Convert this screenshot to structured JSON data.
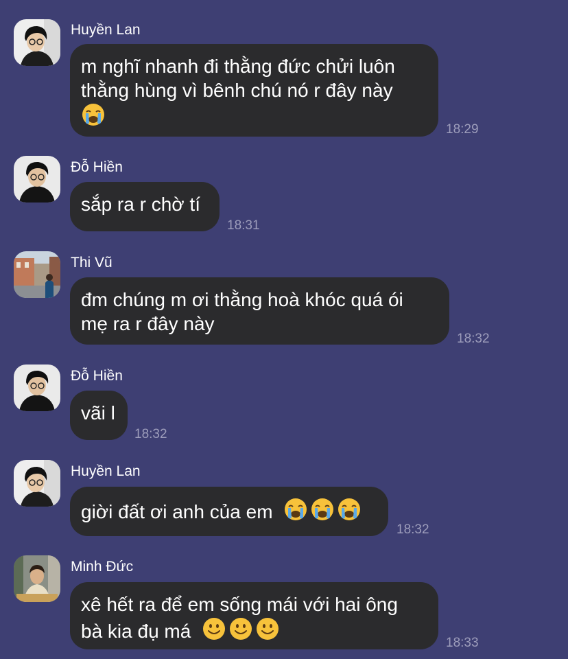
{
  "messages": [
    {
      "sender": "Huyền Lan",
      "avatar": "boy-glasses-avatar",
      "lines": [
        "m nghĩ nhanh đi thằng đức chửi luôn",
        "thằng hùng vì bênh chú nó r đây này"
      ],
      "emoji_line": [
        "loudly-crying-face"
      ],
      "time": "18:29"
    },
    {
      "sender": "Đỗ Hiền",
      "avatar": "boy-dark-avatar",
      "lines": [
        "sắp ra r chờ tí"
      ],
      "time": "18:31"
    },
    {
      "sender": "Thi Vũ",
      "avatar": "street-photo-avatar",
      "lines": [
        "đm chúng m ơi thằng hoà khóc quá ói",
        "mẹ ra r đây này"
      ],
      "time": "18:32"
    },
    {
      "sender": "Đỗ Hiền",
      "avatar": "boy-dark-avatar",
      "lines": [
        "vãi l"
      ],
      "time": "18:32"
    },
    {
      "sender": "Huyền Lan",
      "avatar": "boy-glasses-avatar",
      "lines": [
        "giời đất ơi anh của em"
      ],
      "trailing_emojis": [
        "loudly-crying-face",
        "loudly-crying-face",
        "loudly-crying-face"
      ],
      "time": "18:32"
    },
    {
      "sender": "Minh Đức",
      "avatar": "indoor-photo-avatar",
      "lines": [
        "xê hết ra để em sống mái với hai ông",
        "bà kia đụ má"
      ],
      "trailing_emojis": [
        "slightly-smiling-face",
        "slightly-smiling-face",
        "slightly-smiling-face"
      ],
      "time": "18:33"
    }
  ],
  "colors": {
    "background": "#3e3f73",
    "bubble": "#2b2b2d",
    "text": "#ffffff",
    "timestamp": "#9d9dbb"
  }
}
